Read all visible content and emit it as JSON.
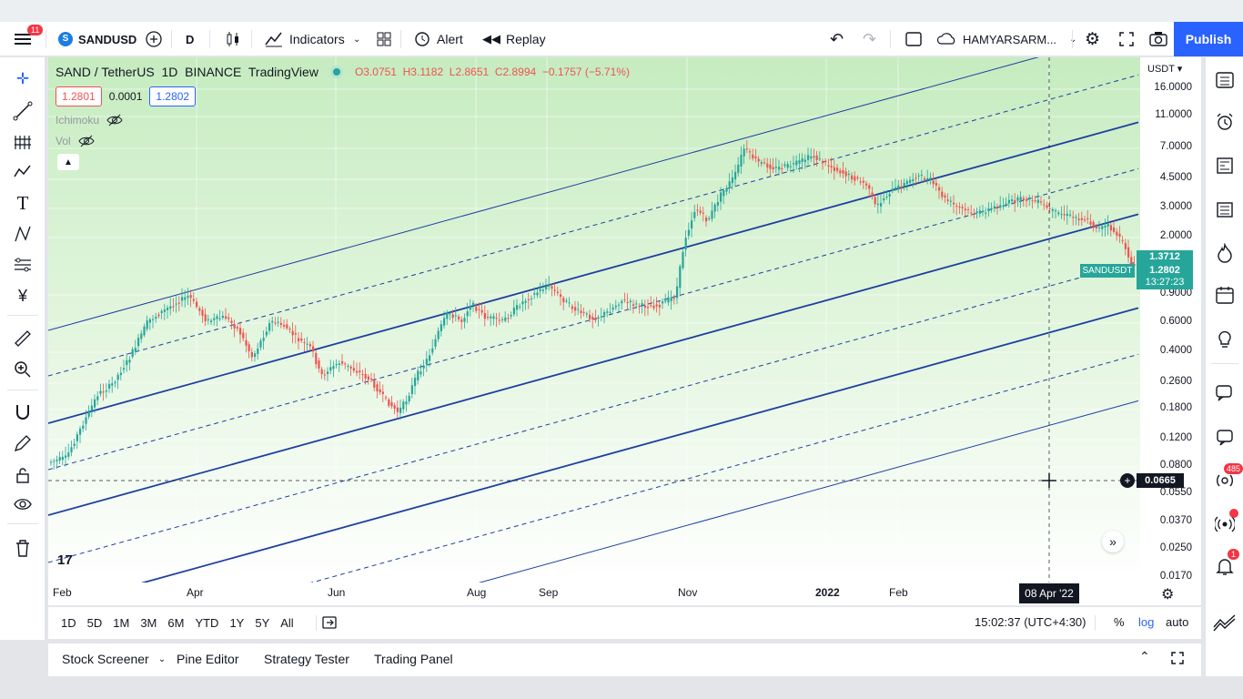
{
  "topbar": {
    "menu_badge": "11",
    "symbol": "SANDUSD",
    "interval": "D",
    "indicators_label": "Indicators",
    "alert_label": "Alert",
    "replay_label": "Replay",
    "layout_name": "HAMYARSARM...",
    "publish_label": "Publish"
  },
  "legend": {
    "title": "SAND / TetherUS  1D  BINANCE  TradingView",
    "ohlc": "O3.0751  H3.1182  L2.8651  C2.8994  −0.1757 (−5.71%)",
    "sell_price": "1.2801",
    "spread": "0.0001",
    "buy_price": "1.2802",
    "indicator1": "Ichimoku",
    "indicator2": "Vol"
  },
  "price_axis": {
    "currency": "USDT",
    "ticks": [
      "16.0000",
      "11.0000",
      "7.0000",
      "4.5000",
      "3.0000",
      "2.0000",
      "0.9000",
      "0.6000",
      "0.4000",
      "0.2600",
      "0.1800",
      "0.1200",
      "0.0800",
      "0.0550",
      "0.0370",
      "0.0250",
      "0.0170"
    ],
    "high_label": "1.3712",
    "symbol_label": "SANDUSDT",
    "last_price": "1.2802",
    "countdown": "13:27:23",
    "crosshair_price": "0.0665"
  },
  "time_axis": {
    "labels": [
      "Feb",
      "Apr",
      "Jun",
      "Aug",
      "Sep",
      "Nov",
      "2022",
      "Feb"
    ],
    "crosshair_date": "08 Apr '22"
  },
  "bottom": {
    "ranges": [
      "1D",
      "5D",
      "1M",
      "3M",
      "6M",
      "YTD",
      "1Y",
      "5Y",
      "All"
    ],
    "clock": "15:02:37 (UTC+4:30)",
    "percent": "%",
    "log": "log",
    "auto": "auto"
  },
  "panels": [
    "Stock Screener",
    "Pine Editor",
    "Strategy Tester",
    "Trading Panel"
  ],
  "right_sidebar": {
    "chat_badge": "485",
    "notif_badge": "1"
  },
  "colors": {
    "accent": "#2962ff",
    "up": "#26a69a",
    "down": "#ef5350",
    "channel": "#1e3fa0",
    "background_gradient_top": "#c9edc4"
  }
}
